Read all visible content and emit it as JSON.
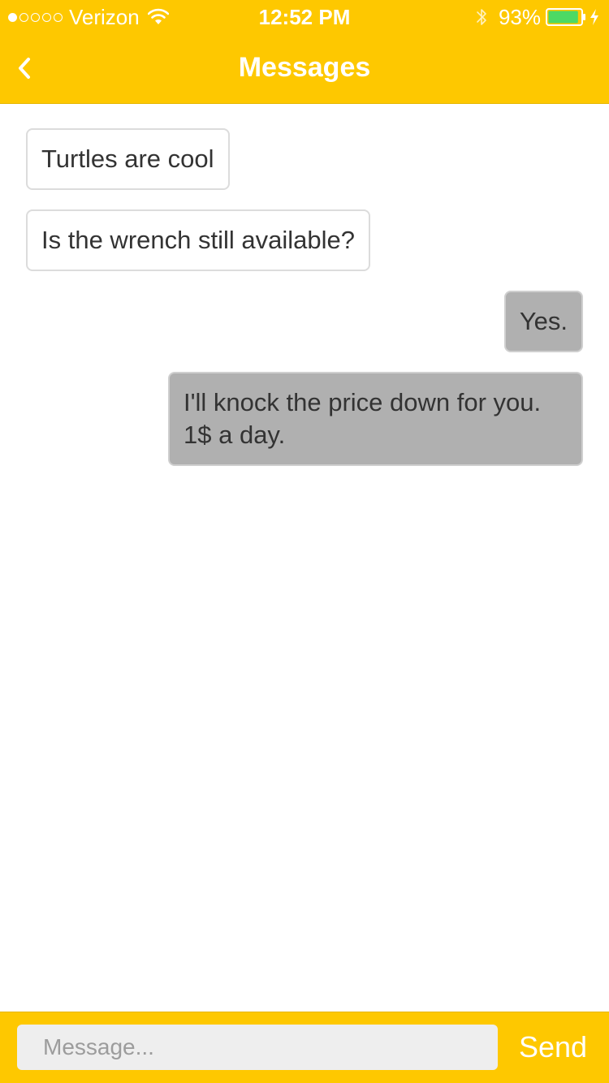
{
  "colors": {
    "accent": "#fec800",
    "outgoing_bubble": "#b0b0b0",
    "incoming_border": "#dcdcdc",
    "battery_fill": "#4cd964"
  },
  "status_bar": {
    "carrier": "Verizon",
    "signal_strength": "1 of 5",
    "time": "12:52 PM",
    "battery_percent": "93%",
    "battery_level": 0.93,
    "icons": [
      "signal-dots-icon",
      "wifi-icon",
      "bluetooth-icon",
      "battery-icon",
      "charging-bolt-icon"
    ]
  },
  "nav": {
    "back_icon": "chevron-left-icon",
    "title": "Messages"
  },
  "messages": [
    {
      "direction": "incoming",
      "text": "Turtles are cool"
    },
    {
      "direction": "incoming",
      "text": "Is the wrench still available?"
    },
    {
      "direction": "outgoing",
      "text": "Yes."
    },
    {
      "direction": "outgoing",
      "text": "I'll knock the price down for you. 1$ a day."
    }
  ],
  "composer": {
    "placeholder": "Message...",
    "value": "",
    "send_label": "Send"
  }
}
